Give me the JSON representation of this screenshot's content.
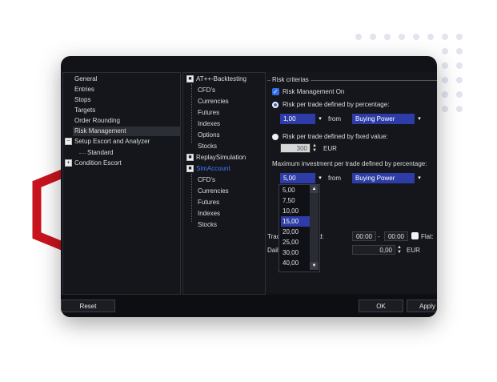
{
  "colors": {
    "accent": "#2d3ca6",
    "checkbox": "#2f6ee8",
    "link": "#3e7bff",
    "window_bg": "#111318",
    "hex_red": "#c8141e"
  },
  "left_tree": {
    "items": [
      {
        "label": "General"
      },
      {
        "label": "Entries"
      },
      {
        "label": "Stops"
      },
      {
        "label": "Targets"
      },
      {
        "label": "Order Rounding"
      },
      {
        "label": "Risk Management"
      },
      {
        "label": "Setup Escort and Analyzer",
        "expander": "−"
      },
      {
        "label": "Standard"
      },
      {
        "label": "Condition Escort",
        "expander": "+"
      }
    ]
  },
  "mid_tree": {
    "backtesting": {
      "label": "AT++-Backtesting",
      "expander": "■"
    },
    "backtesting_children": [
      "CFD's",
      "Currencies",
      "Futures",
      "Indexes",
      "Options",
      "Stocks"
    ],
    "replay": {
      "label": "ReplaySimulation",
      "expander": "■"
    },
    "sim": {
      "label": "SimAccount",
      "expander": "■"
    },
    "sim_children": [
      "CFD's",
      "Currencies",
      "Futures",
      "Indexes",
      "Stocks"
    ]
  },
  "risk": {
    "group_label": "Risk criterias",
    "risk_management_on": "Risk Management On",
    "risk_checkbox_mark": "✓",
    "by_percentage": "Risk per trade defined by percentage:",
    "percentage_value": "1,00",
    "from_label": "from",
    "basis_value": "Buying Power",
    "by_fixed": "Risk per trade defined by fixed value:",
    "fixed_value": "300",
    "currency": "EUR",
    "max_investment": "Maximum investment per trade defined by percentage:",
    "invest_value": "5,00",
    "from_label2": "from",
    "invest_basis": "Buying Power",
    "dropdown_options": [
      "5,00",
      "7,50",
      "10,00",
      "15,00",
      "20,00",
      "25,00",
      "30,00",
      "40,00"
    ],
    "dropdown_selected": "15,00",
    "trade_partial": "Trac",
    "trade_partial_end": "d:",
    "time_from": "00:00",
    "time_sep": "-",
    "time_to": "00:00",
    "flat_label": "Flat:",
    "daily_partial": "Dail",
    "daily_value": "0,00",
    "daily_currency": "EUR",
    "arrow_down": "▾",
    "spin_up": "▲",
    "spin_down": "▼"
  },
  "buttons": {
    "reset": "Reset",
    "ok": "OK",
    "apply": "Apply"
  }
}
